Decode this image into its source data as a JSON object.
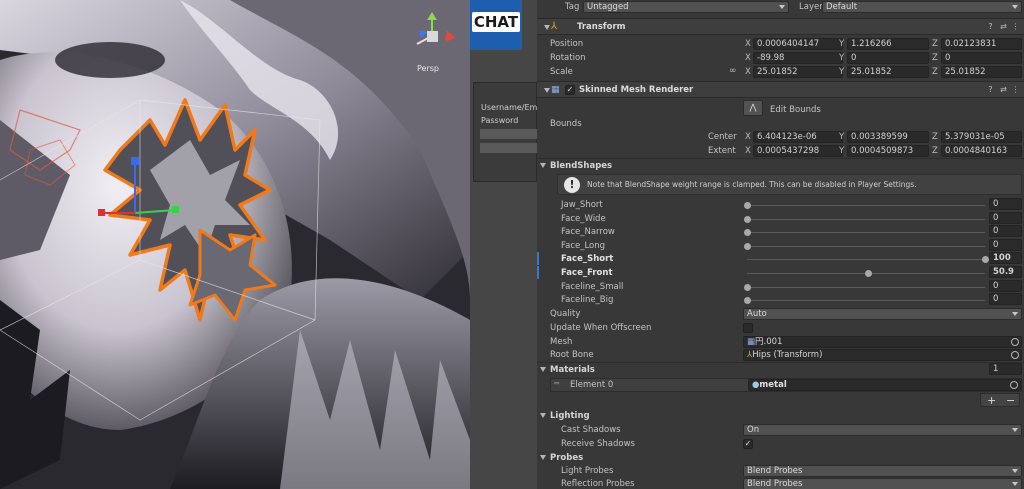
{
  "scene": {
    "gizmo_label": "Persp",
    "gizmo_axes": [
      "Y",
      "X",
      "Z"
    ]
  },
  "game": {
    "logo": "CHAT",
    "fields": [
      "Username/Ema",
      "Password"
    ],
    "colors": {
      "logo_bg": "#1d5fae"
    }
  },
  "inspector": {
    "header": {
      "tag_label": "Tag",
      "tag_value": "Untagged",
      "layer_label": "Layer",
      "layer_value": "Default"
    },
    "transform": {
      "title": "Transform",
      "position": {
        "label": "Position",
        "x": "0.0006404147",
        "y": "1.216266",
        "z": "0.02123831"
      },
      "rotation": {
        "label": "Rotation",
        "x": "-89.98",
        "y": "0",
        "z": "0"
      },
      "scale": {
        "label": "Scale",
        "x": "25.01852",
        "y": "25.01852",
        "z": "25.01852"
      },
      "axes": [
        "X",
        "Y",
        "Z"
      ]
    },
    "smr": {
      "title": "Skinned Mesh Renderer",
      "edit_bounds": "Edit Bounds",
      "bounds_label": "Bounds",
      "center": {
        "label": "Center",
        "x": "6.404123e-06",
        "y": "0.003389599",
        "z": "5.379031e-05"
      },
      "extent": {
        "label": "Extent",
        "x": "0.0005437298",
        "y": "0.0004509873",
        "z": "0.0004840163"
      },
      "blendshapes_title": "BlendShapes",
      "blendshapes_note": "Note that BlendShape weight range is clamped. This can be disabled in Player Settings.",
      "blendshapes": [
        {
          "name": "Jaw_Short",
          "value": "0",
          "fraction": 0
        },
        {
          "name": "Face_Wide",
          "value": "0",
          "fraction": 0
        },
        {
          "name": "Face_Narrow",
          "value": "0",
          "fraction": 0
        },
        {
          "name": "Face_Long",
          "value": "0",
          "fraction": 0
        },
        {
          "name": "Face_Short",
          "value": "100",
          "fraction": 1
        },
        {
          "name": "Face_Front",
          "value": "50.9",
          "fraction": 0.509
        },
        {
          "name": "Faceline_Small",
          "value": "0",
          "fraction": 0
        },
        {
          "name": "Faceline_Big",
          "value": "0",
          "fraction": 0
        }
      ],
      "quality_label": "Quality",
      "quality_value": "Auto",
      "update_offscreen_label": "Update When Offscreen",
      "mesh_label": "Mesh",
      "mesh_value": "円.001",
      "root_bone_label": "Root Bone",
      "root_bone_value": "Hips (Transform)",
      "materials_title": "Materials",
      "materials_count": "1",
      "element0_label": "Element 0",
      "element0_value": "metal",
      "plus": "+",
      "minus": "−",
      "lighting_title": "Lighting",
      "cast_shadows_label": "Cast Shadows",
      "cast_shadows_value": "On",
      "receive_shadows_label": "Receive Shadows",
      "probes_title": "Probes",
      "light_probes_label": "Light Probes",
      "light_probes_value": "Blend Probes",
      "reflection_probes_label": "Reflection Probes",
      "reflection_probes_value": "Blend Probes"
    },
    "colors": {
      "accent": "#3a79bb",
      "panel": "#383838"
    }
  }
}
